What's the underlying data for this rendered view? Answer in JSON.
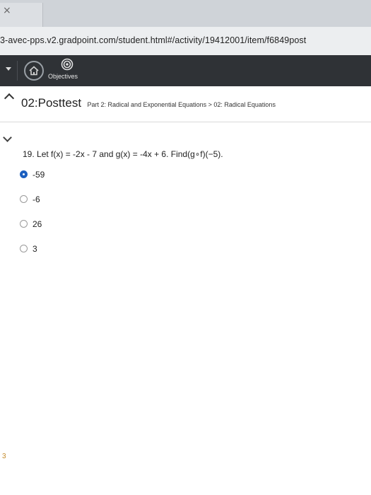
{
  "browser": {
    "tab_close": "×",
    "url": "3-avec-pps.v2.gradpoint.com/student.html#/activity/19412001/item/f6849post"
  },
  "appbar": {
    "objectives_label": "Objectives"
  },
  "header": {
    "title": "02:Posttest",
    "subtitle": "Part 2: Radical and Exponential Equations > 02: Radical Equations"
  },
  "question": {
    "text": "19. Let f(x) = -2x - 7 and g(x) = -4x + 6. Find(g∘f)(−5).",
    "answers": [
      {
        "label": "-59",
        "selected": true
      },
      {
        "label": "-6",
        "selected": false
      },
      {
        "label": "26",
        "selected": false
      },
      {
        "label": "3",
        "selected": false
      }
    ]
  },
  "colors": {
    "appbar_bg": "#2f3236",
    "selected_radio": "#1c5fbf"
  },
  "side_mark": "3"
}
